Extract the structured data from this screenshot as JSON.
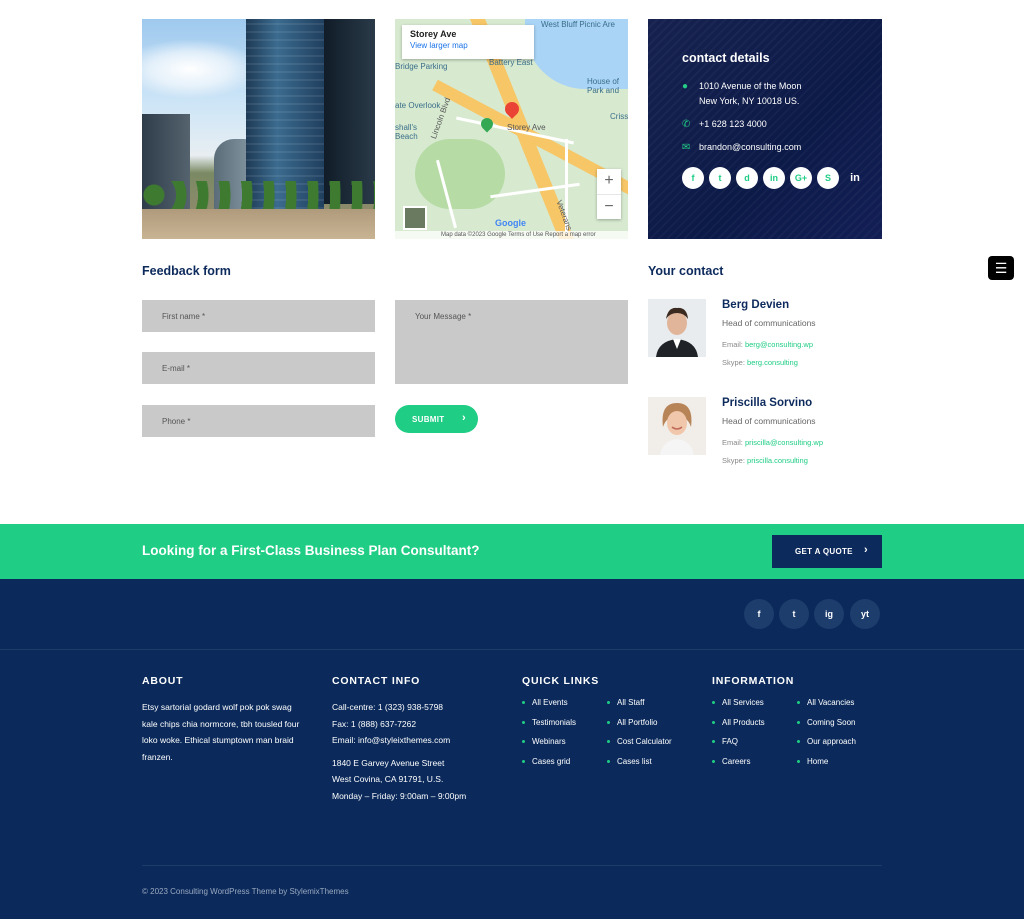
{
  "map": {
    "place_title": "Storey Ave",
    "larger_map_link": "View larger map",
    "labels": {
      "picnic": "West Bluff Picnic Are",
      "battery": "Battery East",
      "bridge": "Bridge Parking",
      "overlook": "ate Overlook",
      "beach": "shall's Beach",
      "house": "House of Park and",
      "storey": "Storey Ave",
      "crissy": "Criss",
      "lincoln": "Lincoln Blvd",
      "veterans": "Veterans"
    },
    "zoom_in": "+",
    "zoom_out": "−",
    "google": "Google",
    "footer_text": "Map data ©2023 Google   Terms of Use   Report a map error"
  },
  "contact_card": {
    "title": "contact details",
    "address_line1": "1010 Avenue of the Moon",
    "address_line2": "New York, NY 10018 US.",
    "phone": "+1 628 123 4000",
    "email": "brandon@consulting.com",
    "socials": [
      "f",
      "t",
      "d",
      "in",
      "G+",
      "S",
      "in"
    ]
  },
  "feedback": {
    "title": "Feedback form",
    "first_name_placeholder": "First name *",
    "email_placeholder": "E-mail *",
    "phone_placeholder": "Phone *",
    "message_placeholder": "Your Message *",
    "submit_label": "SUBMIT"
  },
  "your_contact": {
    "title": "Your contact",
    "people": [
      {
        "name": "Berg Devien",
        "role": "Head of communications",
        "email_label": "Email:",
        "email": "berg@consulting.wp",
        "skype_label": "Skype:",
        "skype": "berg.consulting"
      },
      {
        "name": "Priscilla Sorvino",
        "role": "Head of communications",
        "email_label": "Email:",
        "email": "priscilla@consulting.wp",
        "skype_label": "Skype:",
        "skype": "priscilla.consulting"
      }
    ]
  },
  "banner": {
    "text": "Looking for a First-Class Business Plan Consultant?",
    "button_label": "GET A QUOTE"
  },
  "footer": {
    "socials": [
      "f",
      "t",
      "ig",
      "yt"
    ],
    "about": {
      "title": "ABOUT",
      "text": "Etsy sartorial godard wolf pok pok swag kale chips chia normcore, tbh tousled four loko woke. Ethical stumptown man braid franzen."
    },
    "contact": {
      "title": "CONTACT INFO",
      "call": "Call-centre: 1 (323) 938-5798",
      "fax": "Fax: 1 (888) 637-7262",
      "email": "Email: info@styleixthemes.com",
      "address1": "1840 E Garvey Avenue Street",
      "address2": "West Covina, CA 91791, U.S.",
      "hours": "Monday – Friday: 9:00am – 9:00pm"
    },
    "quick_links": {
      "title": "QUICK LINKS",
      "col1": [
        "All Events",
        "Testimonials",
        "Webinars",
        "Cases grid"
      ],
      "col2": [
        "All Staff",
        "All Portfolio",
        "Cost Calculator",
        "Cases list"
      ]
    },
    "information": {
      "title": "INFORMATION",
      "col1": [
        "All Services",
        "All Products",
        "FAQ",
        "Careers"
      ],
      "col2": [
        "All Vacancies",
        "Coming Soon",
        "Our approach",
        "Home"
      ]
    },
    "copyright": "© 2023 Consulting WordPress Theme by StylemixThemes"
  },
  "menu_icon": "☰",
  "colors": {
    "accent": "#1fcd84",
    "navy": "#0b2a5b",
    "card": "#16214f",
    "field": "#c9c9c9"
  }
}
